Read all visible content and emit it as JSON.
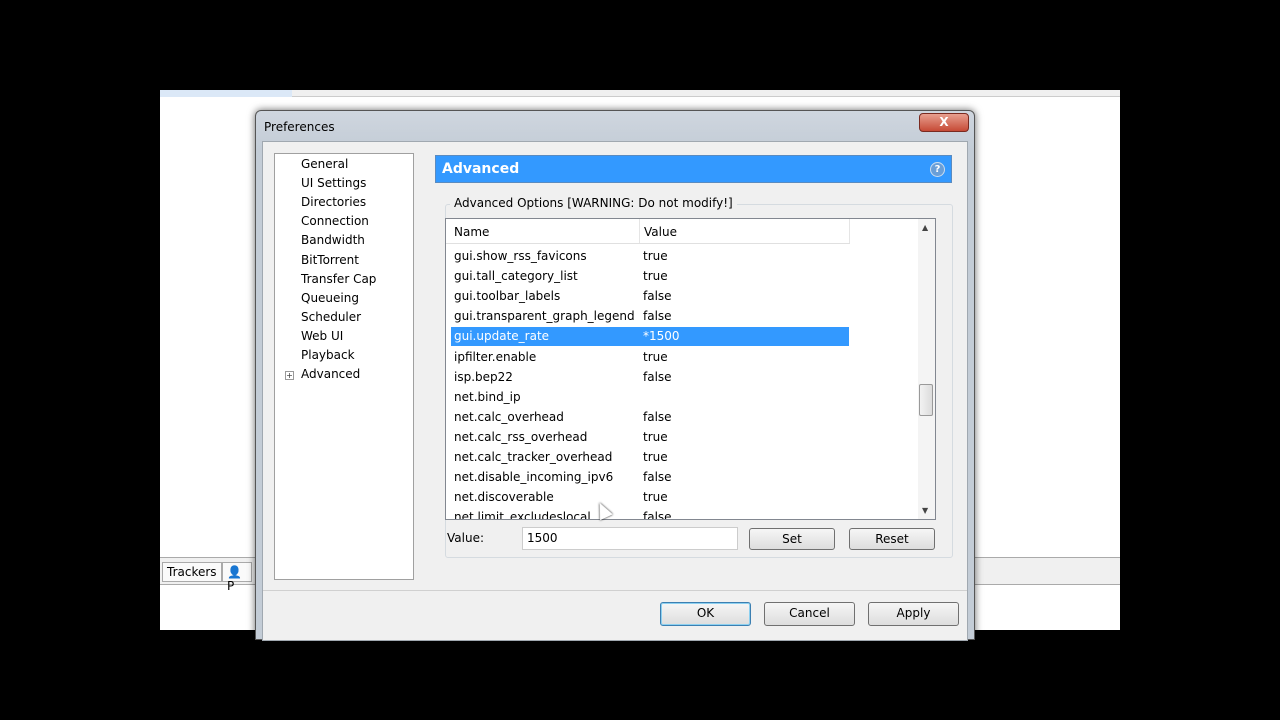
{
  "background_app": {
    "bottom_tabs": [
      "Trackers",
      "P"
    ]
  },
  "dialog": {
    "title": "Preferences",
    "close_label": "X",
    "tree": [
      "General",
      "UI Settings",
      "Directories",
      "Connection",
      "Bandwidth",
      "BitTorrent",
      "Transfer Cap",
      "Queueing",
      "Scheduler",
      "Web UI",
      "Playback",
      "Advanced"
    ],
    "panel_title": "Advanced",
    "help_label": "?",
    "group_label": "Advanced Options [WARNING: Do not modify!]",
    "columns": [
      "Name",
      "Value"
    ],
    "rows": [
      {
        "name": "gui.show_rss_favicons",
        "value": "true"
      },
      {
        "name": "gui.tall_category_list",
        "value": "true"
      },
      {
        "name": "gui.toolbar_labels",
        "value": "false"
      },
      {
        "name": "gui.transparent_graph_legend",
        "value": "false"
      },
      {
        "name": "gui.update_rate",
        "value": "*1500"
      },
      {
        "name": "ipfilter.enable",
        "value": "true"
      },
      {
        "name": "isp.bep22",
        "value": "false"
      },
      {
        "name": "net.bind_ip",
        "value": ""
      },
      {
        "name": "net.calc_overhead",
        "value": "false"
      },
      {
        "name": "net.calc_rss_overhead",
        "value": "true"
      },
      {
        "name": "net.calc_tracker_overhead",
        "value": "true"
      },
      {
        "name": "net.disable_incoming_ipv6",
        "value": "false"
      },
      {
        "name": "net.discoverable",
        "value": "true"
      },
      {
        "name": "net.limit_excludeslocal",
        "value": "false"
      }
    ],
    "selected_row": 4,
    "value_label": "Value:",
    "value": "1500",
    "set_label": "Set",
    "reset_label": "Reset",
    "ok_label": "OK",
    "cancel_label": "Cancel",
    "apply_label": "Apply"
  }
}
